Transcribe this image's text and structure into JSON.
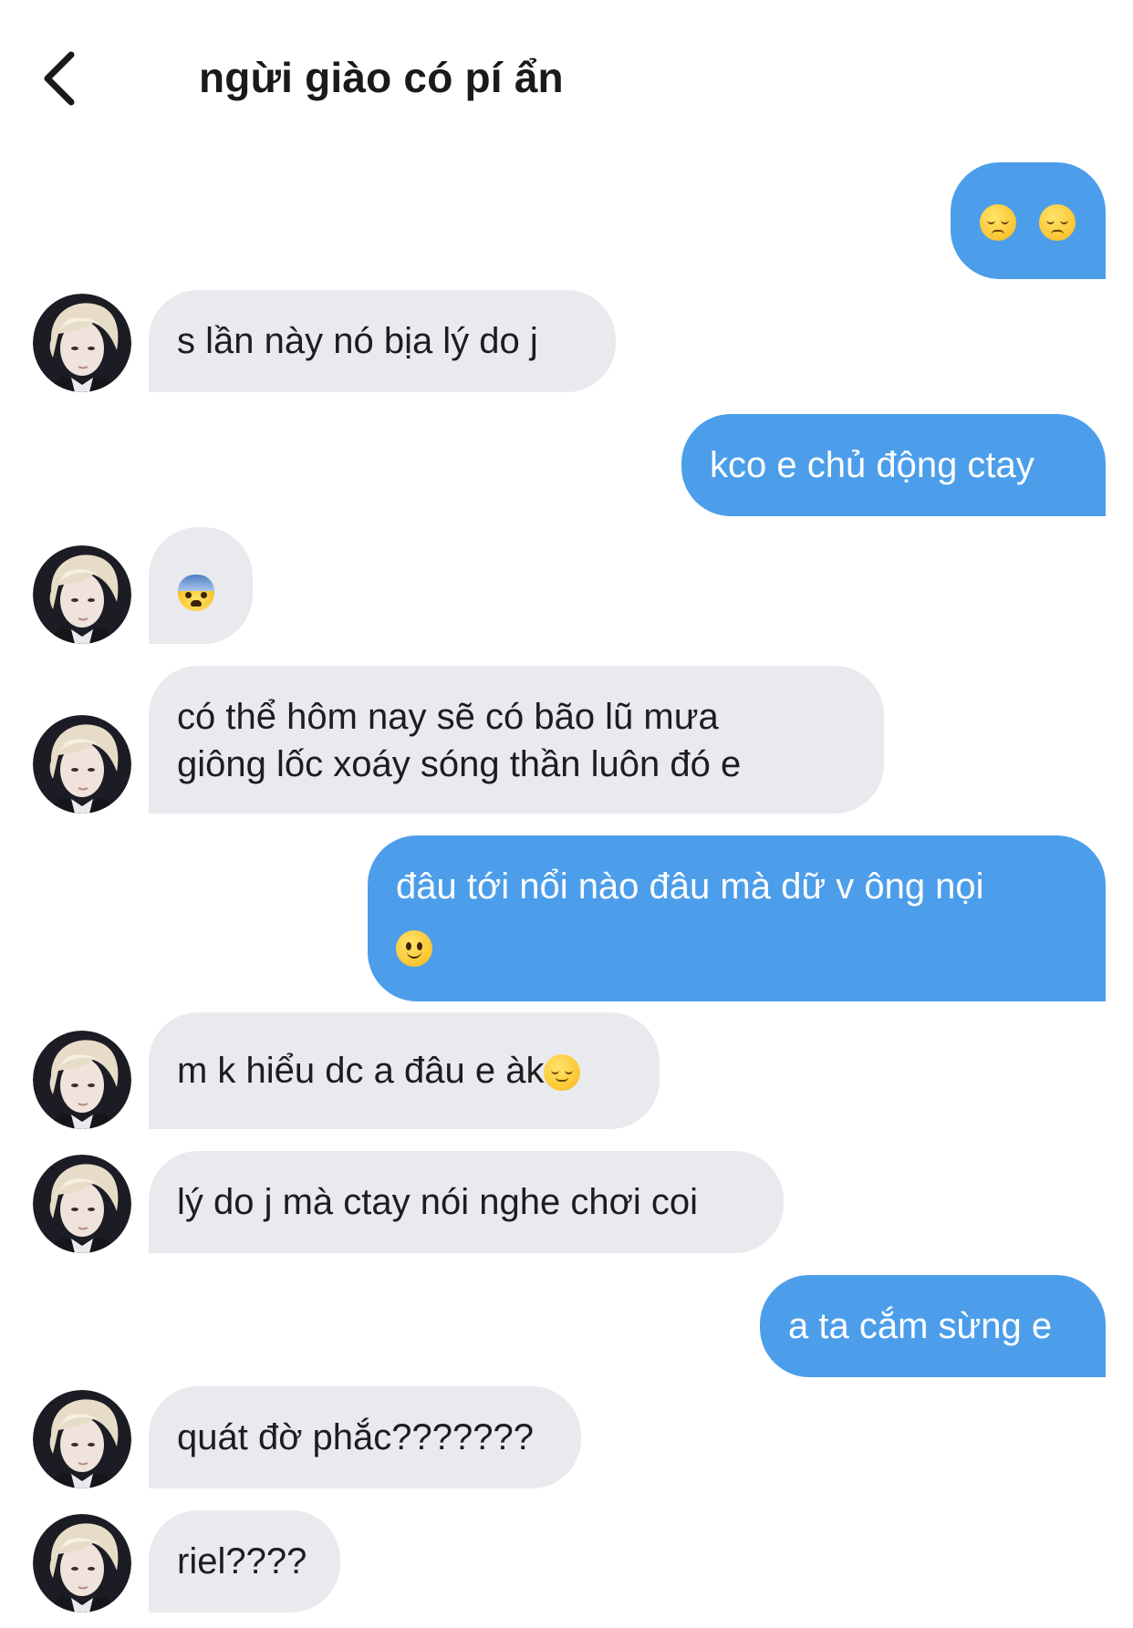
{
  "header": {
    "title": "ngừi giào có pí ẩn",
    "back_icon": "chevron-left-icon"
  },
  "messages": [
    {
      "from": "me",
      "text": "",
      "emoji": [
        "pensive-face-icon",
        "pensive-face-icon"
      ]
    },
    {
      "from": "them",
      "text": "s lần này nó bịa lý do j"
    },
    {
      "from": "me",
      "text": "kco e chủ động ctay"
    },
    {
      "from": "them",
      "text": "",
      "emoji": [
        "fearful-face-icon"
      ]
    },
    {
      "from": "them",
      "text": "có thể hôm nay sẽ có bão lũ mưa",
      "text2": "giông lốc xoáy sóng thần luôn đó e"
    },
    {
      "from": "me",
      "text": "đâu tới nổi nào đâu mà dữ v ông nọi",
      "emoji": [
        "slightly-smiling-face-icon"
      ]
    },
    {
      "from": "them",
      "text": "m k hiểu dc a đâu e àk",
      "emoji": [
        "relieved-face-icon"
      ]
    },
    {
      "from": "them",
      "text": "lý do j mà ctay nói nghe chơi coi"
    },
    {
      "from": "me",
      "text": "a ta cắm sừng e"
    },
    {
      "from": "them",
      "text": "quát đờ phắc???????"
    },
    {
      "from": "them",
      "text": "riel????"
    }
  ],
  "colors": {
    "outgoing_bubble": "#4c9eea",
    "incoming_bubble": "#e8eaee",
    "title_text": "#1a1a1a"
  }
}
